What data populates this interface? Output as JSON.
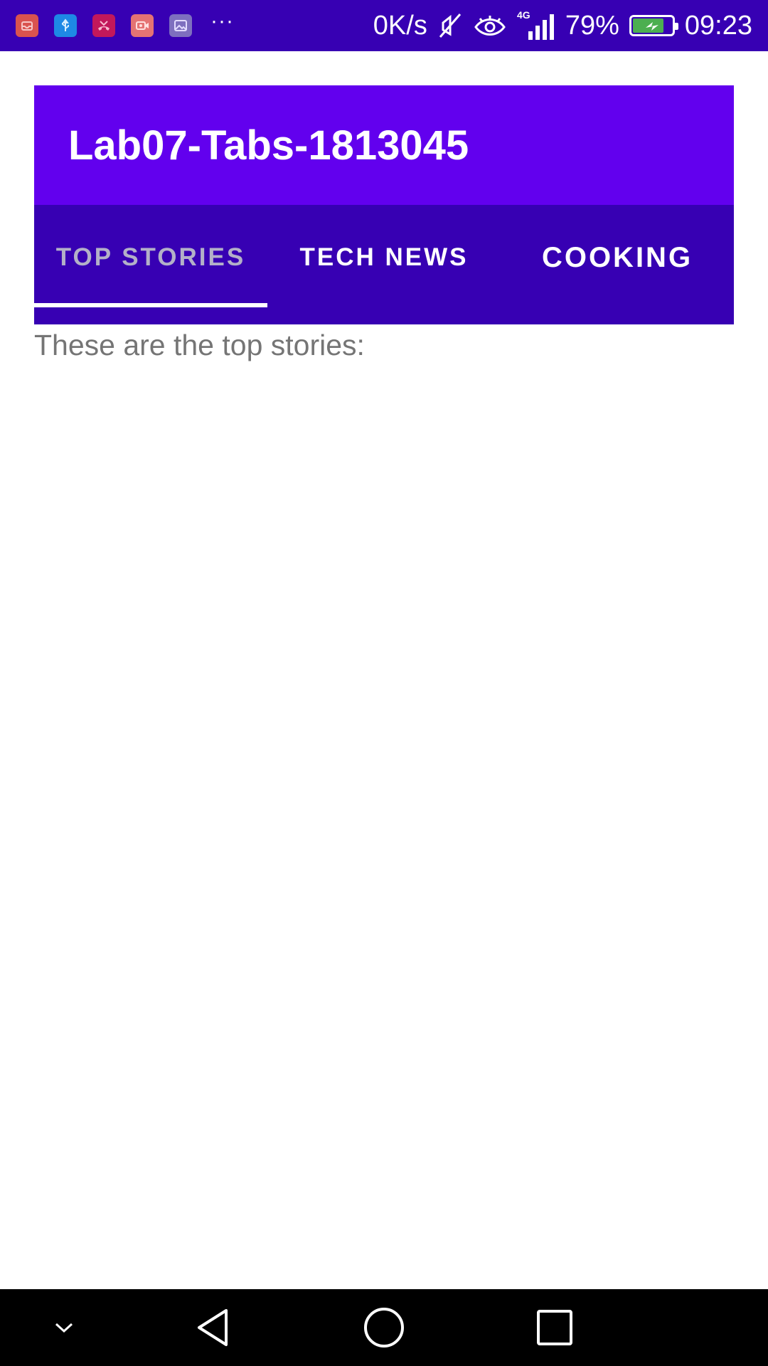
{
  "status_bar": {
    "notification_icons": [
      "mail-icon",
      "usb-icon",
      "missed-call-icon",
      "screen-record-icon",
      "gallery-icon"
    ],
    "more_indicator": "···",
    "network_speed": "0K/s",
    "network_type": "4G",
    "battery_percent": "79%",
    "battery_level": 0.79,
    "time": "09:23"
  },
  "app_bar": {
    "title": "Lab07-Tabs-1813045",
    "color": "#6200ee"
  },
  "tabs": [
    {
      "label": "TOP STORIES",
      "selected": true
    },
    {
      "label": "TECH NEWS",
      "selected": false
    },
    {
      "label": "COOKING",
      "selected": false
    }
  ],
  "tab_bar_color": "#3700b3",
  "content": {
    "text": "These are the top stories:"
  },
  "nav_bar": {
    "buttons": [
      "collapse-icon",
      "back-icon",
      "home-icon",
      "recents-icon"
    ]
  }
}
